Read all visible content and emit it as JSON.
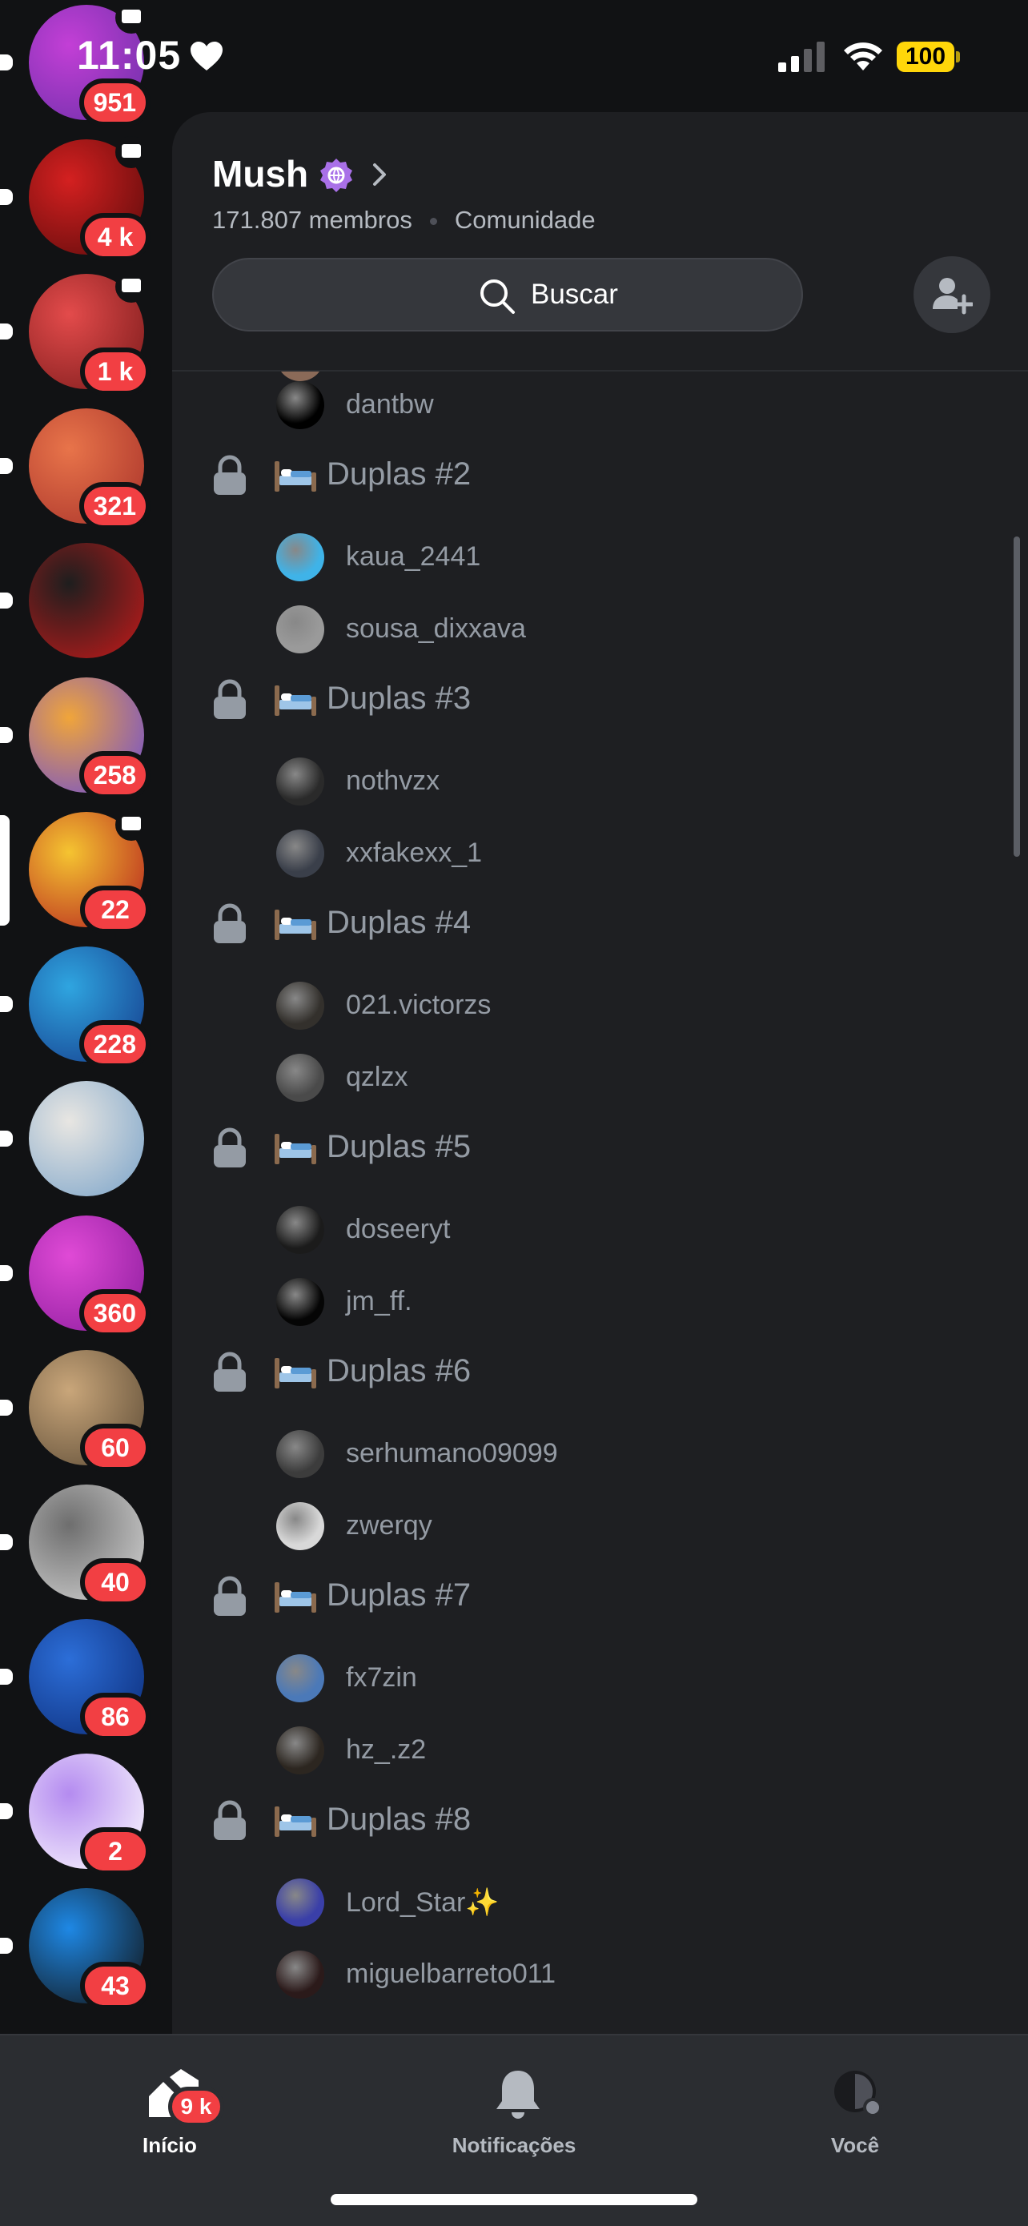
{
  "status": {
    "time": "11:05",
    "battery": "100"
  },
  "rail": {
    "servers": [
      {
        "badge": "951",
        "screen": true,
        "colors": [
          "#6b2fa8",
          "#c33fd6"
        ]
      },
      {
        "badge": "4 k",
        "screen": true,
        "colors": [
          "#5a0b0b",
          "#d42020"
        ]
      },
      {
        "badge": "1 k",
        "screen": true,
        "colors": [
          "#7a1a1a",
          "#e34b4b"
        ]
      },
      {
        "badge": "321",
        "screen": false,
        "colors": [
          "#a8322a",
          "#e8744a"
        ]
      },
      {
        "badge": "",
        "screen": false,
        "colors": [
          "#c51a1a",
          "#1e1e1e"
        ]
      },
      {
        "badge": "258",
        "screen": false,
        "colors": [
          "#6a4bd8",
          "#f0a53a"
        ]
      },
      {
        "badge": "22",
        "screen": true,
        "colors": [
          "#b41e1e",
          "#f5c431"
        ],
        "selected": true
      },
      {
        "badge": "228",
        "screen": false,
        "colors": [
          "#153a8a",
          "#2fa5e0"
        ]
      },
      {
        "badge": "",
        "screen": false,
        "colors": [
          "#7aa3c9",
          "#e8e6e2"
        ]
      },
      {
        "badge": "360",
        "screen": false,
        "colors": [
          "#8a1c9c",
          "#e04ad6"
        ]
      },
      {
        "badge": "60",
        "screen": false,
        "colors": [
          "#5b4a35",
          "#c9a67a"
        ]
      },
      {
        "badge": "40",
        "screen": false,
        "colors": [
          "#d7d7d7",
          "#6e6e6e"
        ]
      },
      {
        "badge": "86",
        "screen": false,
        "colors": [
          "#0c2c78",
          "#2c6ed8"
        ]
      },
      {
        "badge": "2",
        "screen": false,
        "colors": [
          "#ffffff",
          "#b48bf0"
        ]
      },
      {
        "badge": "43",
        "screen": false,
        "colors": [
          "#111111",
          "#1e88e5"
        ]
      }
    ]
  },
  "guild": {
    "name": "Mush",
    "members": "171.807 membros",
    "type": "Comunidade",
    "search_placeholder": "Buscar"
  },
  "list": {
    "rows": [
      {
        "kind": "member",
        "name": "dantbw",
        "avatar": "#000000"
      },
      {
        "kind": "category",
        "name": "Duplas #2"
      },
      {
        "kind": "member",
        "name": "kaua_2441",
        "avatar": "#3fb3e8"
      },
      {
        "kind": "member",
        "name": "sousa_dixxava",
        "avatar": "#9a9a9a"
      },
      {
        "kind": "category",
        "name": "Duplas #3"
      },
      {
        "kind": "member",
        "name": "nothvzx",
        "avatar": "#2a2a2a"
      },
      {
        "kind": "member",
        "name": "xxfakexx_1",
        "avatar": "#3a3f4a"
      },
      {
        "kind": "category",
        "name": "Duplas #4"
      },
      {
        "kind": "member",
        "name": "021.victorzs",
        "avatar": "#33302c"
      },
      {
        "kind": "member",
        "name": "qzlzx",
        "avatar": "#4a4a4a"
      },
      {
        "kind": "category",
        "name": "Duplas #5"
      },
      {
        "kind": "member",
        "name": "doseeryt",
        "avatar": "#1b1b1b"
      },
      {
        "kind": "member",
        "name": "jm_ff.",
        "avatar": "#050505"
      },
      {
        "kind": "category",
        "name": "Duplas #6"
      },
      {
        "kind": "member",
        "name": "serhumano09099",
        "avatar": "#3c3c3c"
      },
      {
        "kind": "member",
        "name": "zwerqy",
        "avatar": "#d8d8d8"
      },
      {
        "kind": "category",
        "name": "Duplas #7"
      },
      {
        "kind": "member",
        "name": "fx7zin",
        "avatar": "#4b79b8"
      },
      {
        "kind": "member",
        "name": "hz_.z2",
        "avatar": "#2c2620"
      },
      {
        "kind": "category",
        "name": "Duplas #8"
      },
      {
        "kind": "member",
        "name": "Lord_Star✨",
        "avatar": "#3a3fa8"
      },
      {
        "kind": "member",
        "name": "miguelbarreto011",
        "avatar": "#2b1a1a"
      }
    ]
  },
  "tabs": [
    {
      "label": "Início",
      "badge": "9 k",
      "icon": "home-icon",
      "active": true
    },
    {
      "label": "Notificações",
      "badge": "",
      "icon": "bell-icon",
      "active": false
    },
    {
      "label": "Você",
      "badge": "",
      "icon": "profile-icon",
      "active": false
    }
  ]
}
